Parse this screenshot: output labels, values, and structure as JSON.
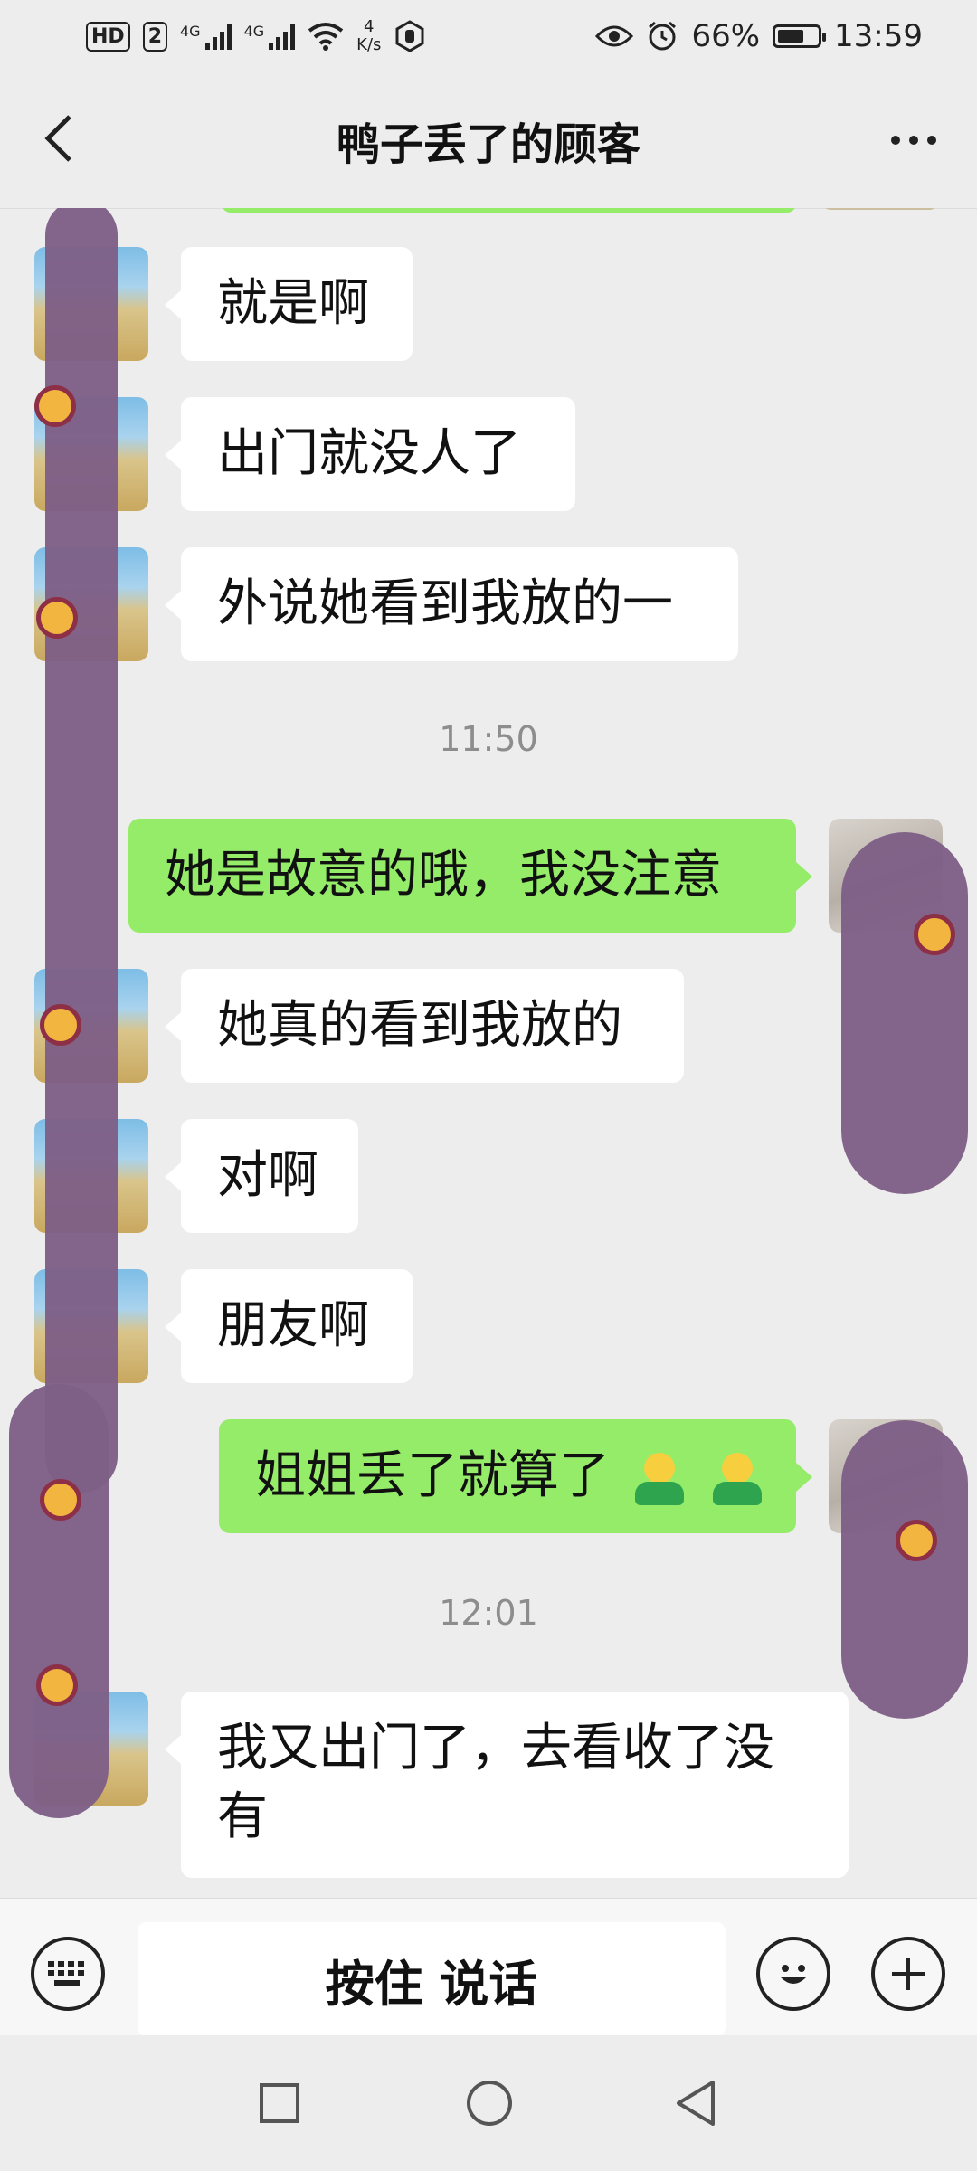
{
  "status_bar": {
    "hd_label": "HD",
    "sim_slot": "2",
    "network_label_1": "4G",
    "network_label_2": "4G",
    "net_speed_value": "4",
    "net_speed_unit": "K/s",
    "battery_percent": "66%",
    "battery_level": 0.66,
    "time": "13:59"
  },
  "header": {
    "title": "鸭子丢了的顾客",
    "back_icon": "chevron-left-icon",
    "more_icon": "more-dots-icon"
  },
  "messages": [
    {
      "side": "in",
      "text": "就是啊"
    },
    {
      "side": "in",
      "text": "出门就没人了"
    },
    {
      "side": "in",
      "text": "外说她看到我放的一"
    },
    {
      "type": "time",
      "text": "11:50"
    },
    {
      "side": "out",
      "text": "她是故意的哦，我没注意"
    },
    {
      "side": "in",
      "text": "她真的看到我放的"
    },
    {
      "side": "in",
      "text": "对啊"
    },
    {
      "side": "in",
      "text": "朋友啊"
    },
    {
      "side": "out",
      "text": "姐姐丢了就算了",
      "emojis": [
        "person-emoji",
        "person-emoji"
      ]
    },
    {
      "type": "time",
      "text": "12:01"
    },
    {
      "side": "in",
      "text": "我又出门了，去看收了没有"
    }
  ],
  "input_bar": {
    "keyboard_icon": "keyboard-icon",
    "hold_to_talk_label": "按住 说话",
    "emoji_icon": "smiley-icon",
    "plus_icon": "plus-icon"
  },
  "nav_bar": {
    "recent_icon": "square-icon",
    "home_icon": "circle-icon",
    "back_icon": "triangle-back-icon"
  },
  "colors": {
    "background": "#ededed",
    "incoming_bubble": "#ffffff",
    "outgoing_bubble": "#95ec69",
    "timestamp": "#8d8d8d",
    "doodle": "#7e5f86"
  }
}
